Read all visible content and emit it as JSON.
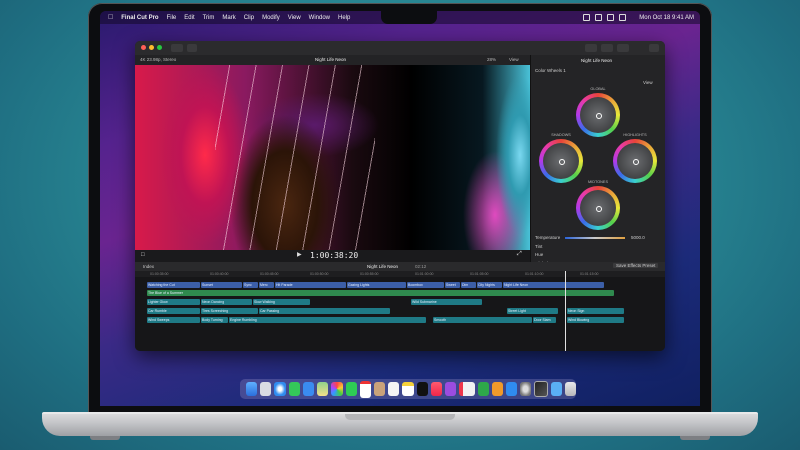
{
  "menubar": {
    "app": "Final Cut Pro",
    "items": [
      "File",
      "Edit",
      "Trim",
      "Mark",
      "Clip",
      "Modify",
      "View",
      "Window",
      "Help"
    ],
    "datetime": "Mon Oct 18  9:41 AM"
  },
  "viewer": {
    "format": "4K 23.98p, Stereo",
    "title": "Night Life Neon",
    "zoom": "28%",
    "view_label": "View",
    "timecode": "1:00:38:20"
  },
  "inspector": {
    "title": "Night Life Neon",
    "effect": "Color Wheels 1",
    "view_label": "View",
    "wheels": [
      "GLOBAL",
      "SHADOWS",
      "HIGHLIGHTS",
      "MIDTONES"
    ],
    "temperature_label": "Temperature",
    "temperature_value": "5000.0",
    "tint_label": "Tint",
    "hue_label": "Hue",
    "preset_label": "Global",
    "save_button": "Save Effects Preset"
  },
  "timeline": {
    "index_label": "Index",
    "project": "Night Life Neon",
    "duration": "02:12",
    "ruler": [
      "01:00:35:00",
      "01:00:40:00",
      "01:00:45:00",
      "01:00:50:00",
      "01:00:55:00",
      "01:01:00:00",
      "01:01:05:00",
      "01:01:10:00",
      "01:01:15:00"
    ],
    "clips_row1": [
      "Watching the Cut",
      "Sunset",
      "Sync",
      "Merc",
      "Hit Parade",
      "Gazing Lights",
      "Boombox",
      "Sweet",
      "Dim",
      "City Nights",
      "Night Life Neon"
    ],
    "clips_row2": [
      "The Blue of a Summer"
    ],
    "clips_row3": [
      "Lighter Glow",
      "Neon Dancing",
      "Slow Walking",
      "Wild Submarine"
    ],
    "clips_row4": [
      "Car Rumble",
      "Tires Screeching",
      "Car Passing",
      "Street Light",
      "Neon Sign"
    ],
    "clips_row5": [
      "Wind Sweeps",
      "Body Turning",
      "Engine Rumbling",
      "Smooth",
      "Door Slam",
      "Wind Blowing"
    ]
  },
  "dock_icons": [
    "finder-icon",
    "launchpad-icon",
    "safari-icon",
    "messages-icon",
    "mail-icon",
    "maps-icon",
    "photos-icon",
    "facetime-icon",
    "calendar-icon",
    "contacts-icon",
    "reminders-icon",
    "notes-icon",
    "tv-icon",
    "music-icon",
    "podcasts-icon",
    "news-icon",
    "numbers-icon",
    "keynote-icon",
    "appstore-icon",
    "settings-icon",
    "finalcut-icon",
    "downloads-icon",
    "trash-icon"
  ],
  "colors": {
    "accent": "#3c5fa8",
    "clip_green": "#2f8a4e",
    "clip_teal": "#1f7a86"
  }
}
